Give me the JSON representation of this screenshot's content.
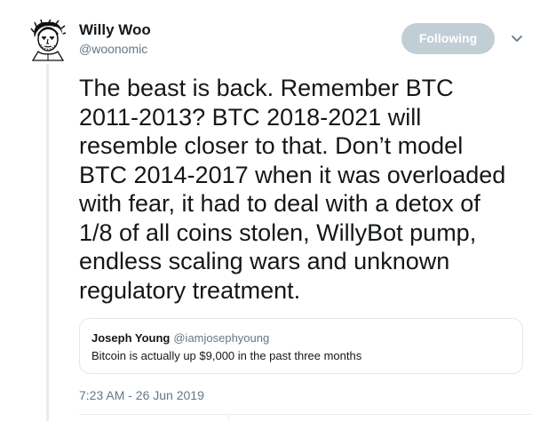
{
  "author": {
    "display_name": "Willy Woo",
    "handle": "@woonomic",
    "avatar_icon": "cartoon-portrait-avatar"
  },
  "follow_button": {
    "label": "Following"
  },
  "menu": {
    "icon": "chevron-down-icon"
  },
  "tweet": {
    "text": "The beast is back. Remember BTC\n2011-2013? BTC 2018-2021 will\nresemble closer to that. Don’t model\nBTC 2014-2017 when it was overloaded\nwith fear, it had to deal with a detox of\n1/8 of all coins stolen, WillyBot pump,\nendless scaling wars and unknown\nregulatory treatment.",
    "timestamp": "7:23 AM - 26 Jun 2019"
  },
  "quoted_tweet": {
    "author_name": "Joseph Young",
    "author_handle": "@iamjosephyoung",
    "text": "Bitcoin is actually up $9,000 in the past three months"
  },
  "colors": {
    "text": "#14171a",
    "secondary_text": "#657786",
    "following_button_bg": "#c2ced6",
    "border": "#e1e8ed"
  }
}
